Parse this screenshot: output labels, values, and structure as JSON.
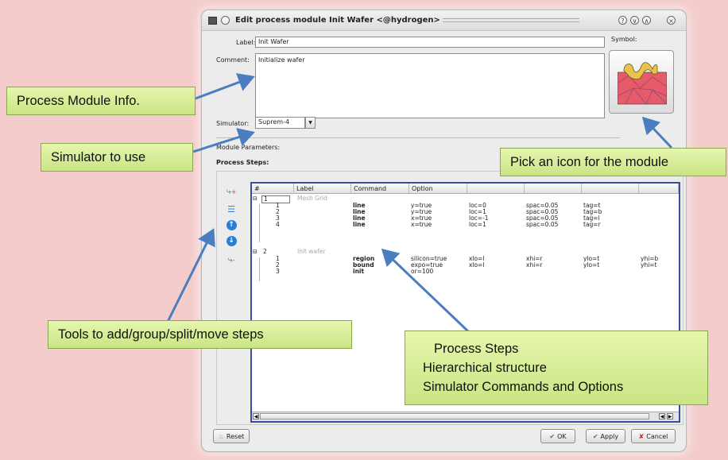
{
  "dialog": {
    "title": "Edit process module Init Wafer <@hydrogen>",
    "label_caption": "Label:",
    "label_value": "Init Wafer",
    "symbol_caption": "Symbol:",
    "comment_caption": "Comment:",
    "comment_value": "Initialize wafer",
    "simulator_caption": "Simulator:",
    "simulator_value": "Suprem-4",
    "module_params_caption": "Module Parameters:",
    "process_steps_caption": "Process Steps:",
    "buttons": {
      "reset": "Reset",
      "ok": "OK",
      "apply": "Apply",
      "cancel": "Cancel"
    }
  },
  "steps_table": {
    "headers": [
      "#",
      "Label",
      "Command",
      "Option"
    ],
    "groups": [
      {
        "num": "1",
        "label": "Mesh Grid"
      },
      {
        "num": "2",
        "label": "Init wafer"
      }
    ],
    "rows": [
      {
        "sub": "1",
        "command": "line",
        "o1": "y=true",
        "o2": "loc=0",
        "o3": "spac=0.05",
        "o4": "tag=t",
        "o5": ""
      },
      {
        "sub": "2",
        "command": "line",
        "o1": "y=true",
        "o2": "loc=1",
        "o3": "spac=0.05",
        "o4": "tag=b",
        "o5": ""
      },
      {
        "sub": "3",
        "command": "line",
        "o1": "x=true",
        "o2": "loc=-1",
        "o3": "spac=0.05",
        "o4": "tag=l",
        "o5": ""
      },
      {
        "sub": "4",
        "command": "line",
        "o1": "x=true",
        "o2": "loc=1",
        "o3": "spac=0.05",
        "o4": "tag=r",
        "o5": ""
      },
      {
        "sub": "1",
        "command": "region",
        "o1": "silicon=true",
        "o2": "xlo=l",
        "o3": "xhi=r",
        "o4": "ylo=t",
        "o5": "yhi=b"
      },
      {
        "sub": "2",
        "command": "bound",
        "o1": "expo=true",
        "o2": "xlo=l",
        "o3": "xhi=r",
        "o4": "ylo=t",
        "o5": "yhi=t"
      },
      {
        "sub": "3",
        "command": "init",
        "o1": "or=100",
        "o2": "",
        "o3": "",
        "o4": "",
        "o5": ""
      }
    ]
  },
  "callouts": {
    "process_module_info": "Process Module Info.",
    "simulator_to_use": "Simulator to use",
    "pick_icon": "Pick an icon for the module",
    "tools": "Tools to add/group/split/move steps",
    "steps_title": "Process Steps",
    "steps_bullet_1": "Hierarchical structure",
    "steps_bullet_2": "Simulator Commands and Options"
  },
  "colors": {
    "background": "#f4cccc",
    "callout_fill": "#d7ee98",
    "arrow": "#4a7ec0",
    "table_border": "#3a4d9b"
  },
  "icons": [
    "window-menu-icon",
    "help-icon",
    "minimize-icon",
    "maximize-icon",
    "close-icon",
    "add-step-icon",
    "group-steps-icon",
    "move-up-icon",
    "move-down-icon",
    "split-step-icon",
    "reset-icon",
    "ok-icon",
    "apply-icon",
    "cancel-icon",
    "dropdown-arrow-icon",
    "module-symbol-icon"
  ]
}
